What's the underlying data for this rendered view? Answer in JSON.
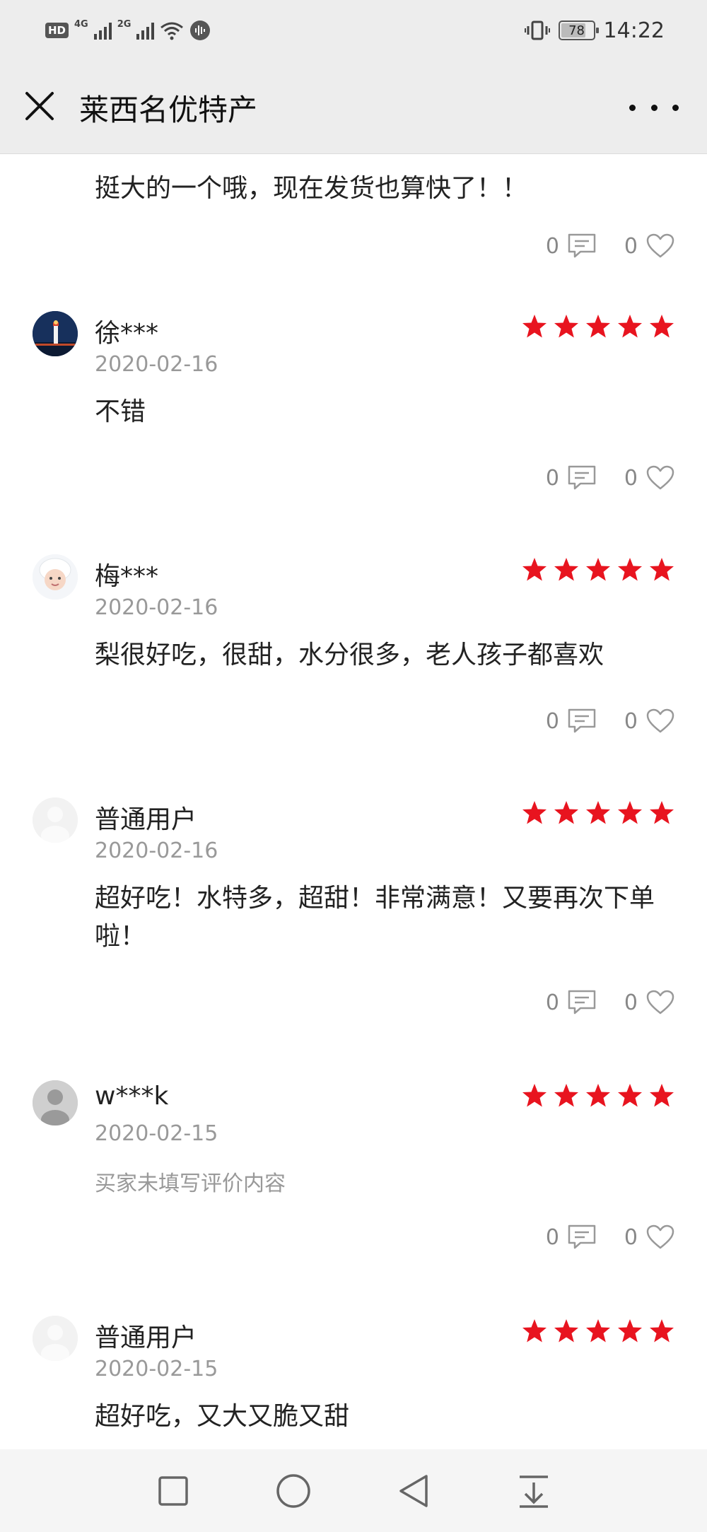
{
  "status_bar": {
    "hd": "HD",
    "net1": "4G",
    "net2": "2G",
    "battery": "78",
    "battery_level": 0.78,
    "time": "14:22"
  },
  "header": {
    "title": "莱西名优特产"
  },
  "colors": {
    "star": "#e8141f",
    "header_bg": "#ededed",
    "muted": "#999999"
  },
  "partial_review": {
    "text": "挺大的一个哦，现在发货也算快了！！",
    "comments": "0",
    "likes": "0"
  },
  "reviews": [
    {
      "user": "徐***",
      "date": "2020-02-16",
      "stars": 5,
      "text": "不错",
      "comments": "0",
      "likes": "0",
      "avatar": "night-lighthouse"
    },
    {
      "user": "梅***",
      "date": "2020-02-16",
      "stars": 5,
      "text": "梨很好吃，很甜，水分很多，老人孩子都喜欢",
      "comments": "0",
      "likes": "0",
      "avatar": "baby-photo"
    },
    {
      "user": "普通用户",
      "date": "2020-02-16",
      "stars": 5,
      "text": "超好吃！水特多，超甜！非常满意！又要再次下单啦！",
      "comments": "0",
      "likes": "0",
      "avatar": "default-light"
    },
    {
      "user": "w***k",
      "date": "2020-02-15",
      "stars": 5,
      "text": "买家未填写评价内容",
      "comments": "0",
      "likes": "0",
      "avatar": "default-gray"
    },
    {
      "user": "普通用户",
      "date": "2020-02-15",
      "stars": 5,
      "text": "超好吃，又大又脆又甜",
      "avatar": "default-light"
    }
  ],
  "nav": [
    "recent-apps",
    "home",
    "back",
    "notification-pull"
  ]
}
